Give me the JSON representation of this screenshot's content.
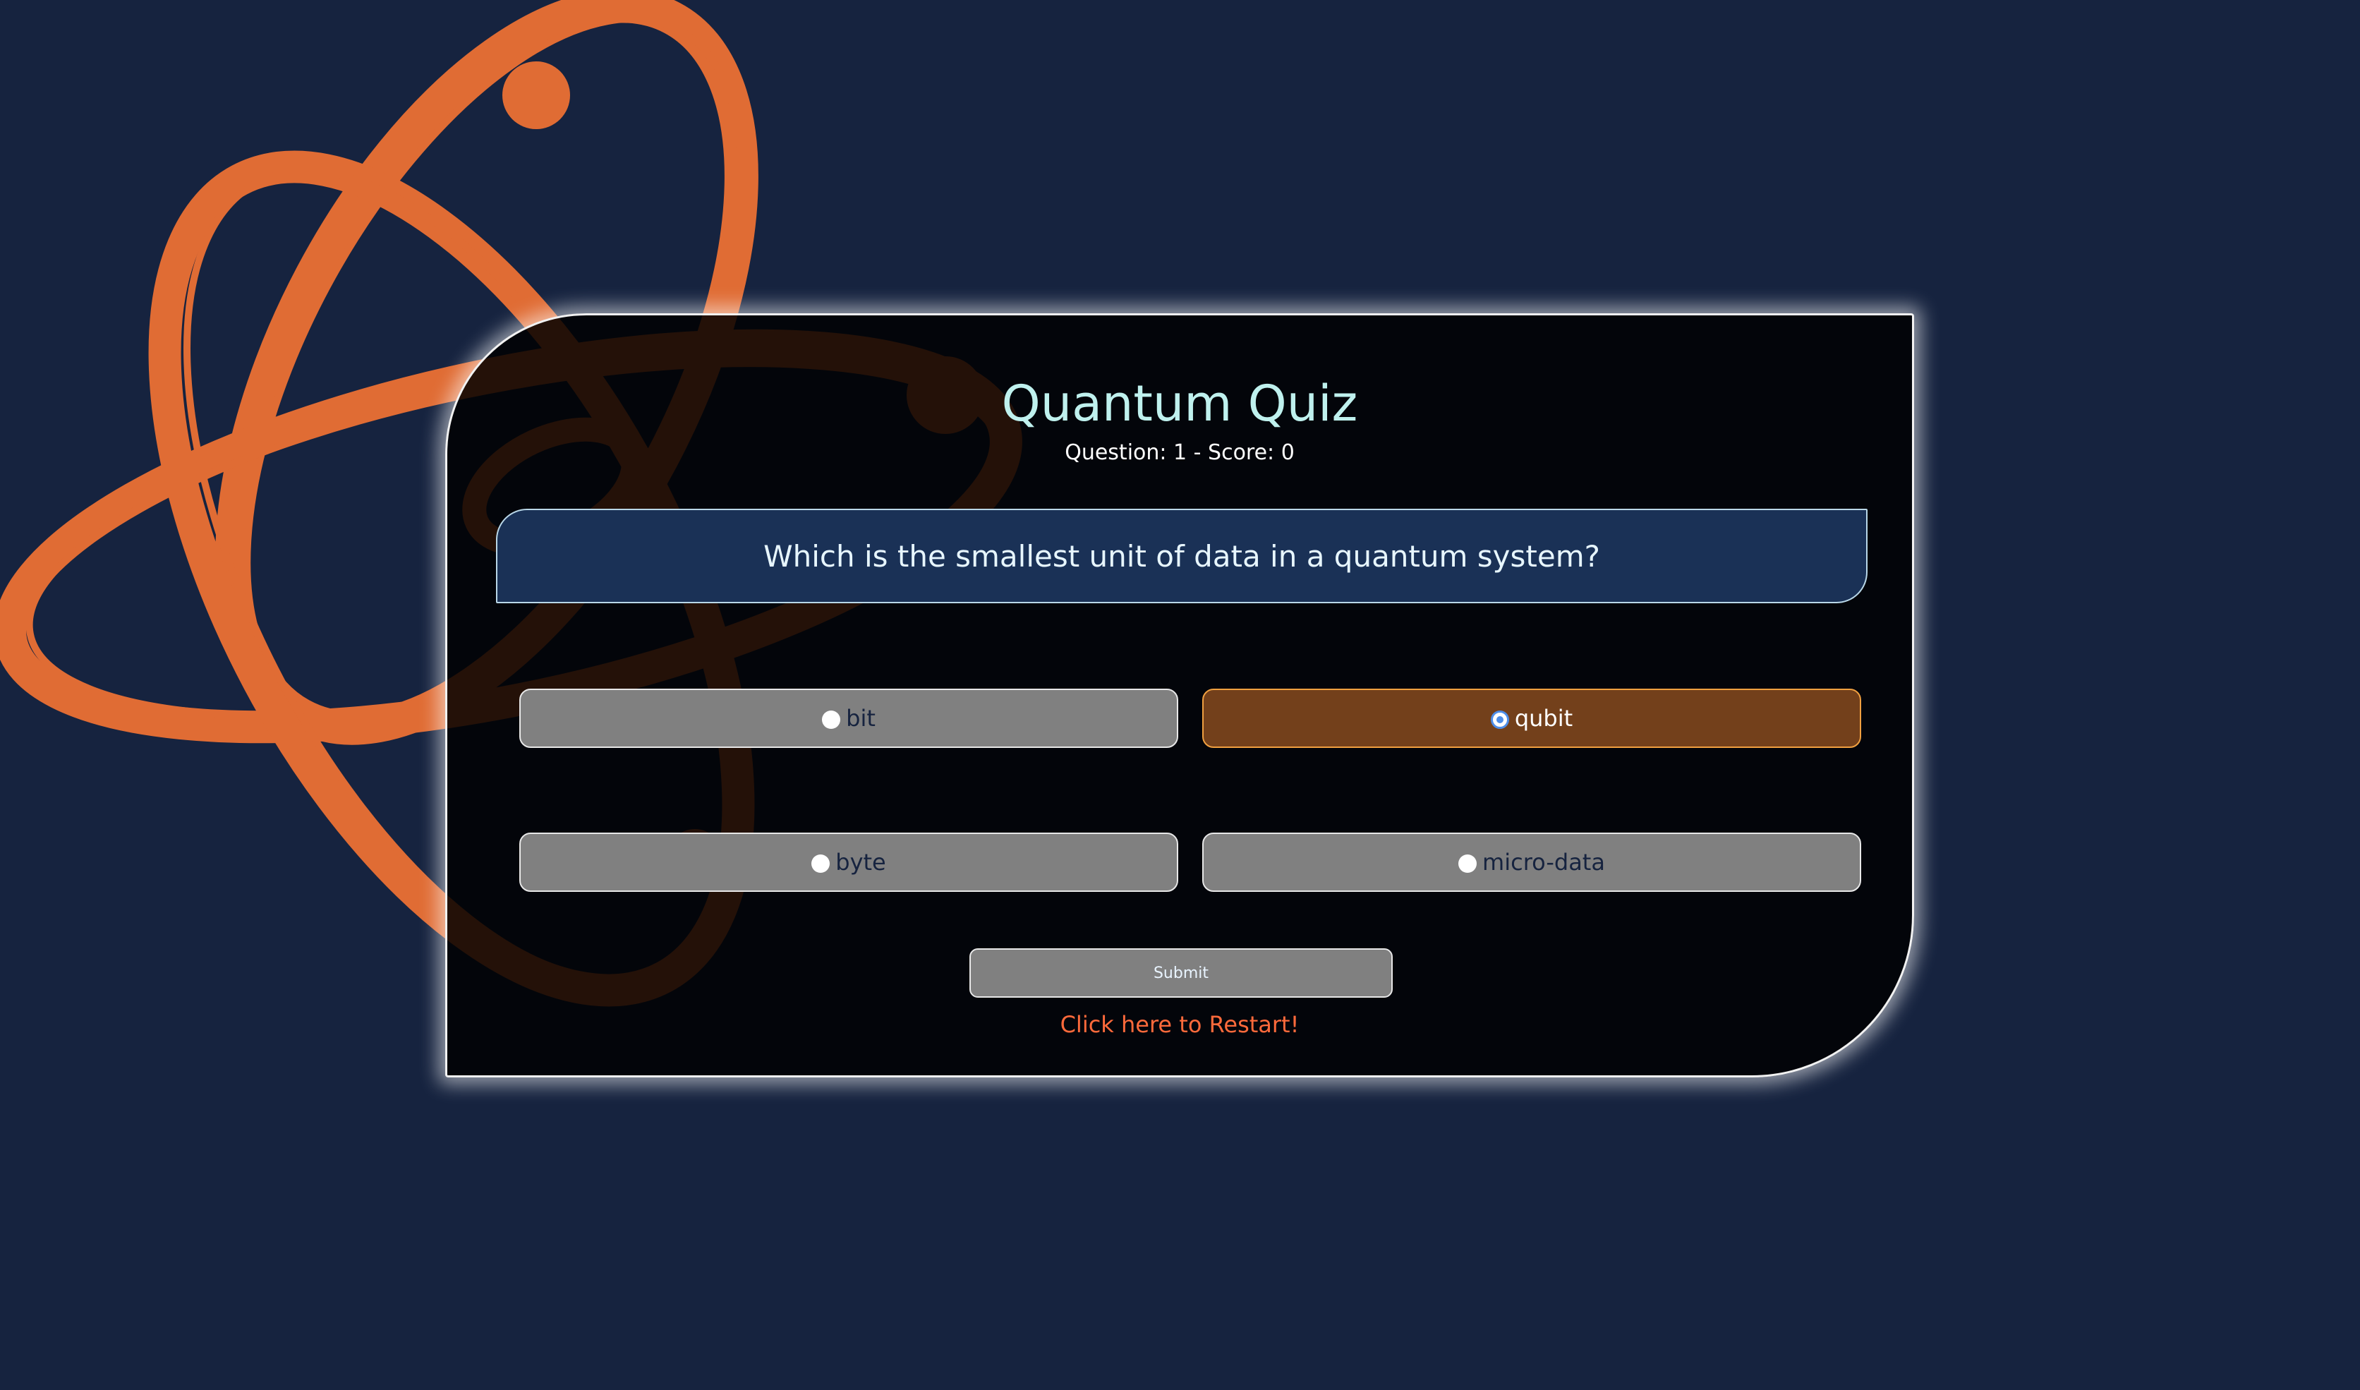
{
  "quiz": {
    "title": "Quantum Quiz",
    "status": "Question: 1 - Score: 0",
    "question": "Which is the smallest unit of data in a quantum system?",
    "options": [
      {
        "label": "bit",
        "selected": false
      },
      {
        "label": "qubit",
        "selected": true
      },
      {
        "label": "byte",
        "selected": false
      },
      {
        "label": "micro-data",
        "selected": false
      }
    ],
    "submit_label": "Submit",
    "restart_label": "Click here to Restart!"
  },
  "colors": {
    "background": "#16233f",
    "atom_logo": "#e06c34",
    "selected_option": "#73401b",
    "title": "#bff1ee",
    "restart": "#ff6a3b"
  },
  "icons": {
    "background_logo": "atom-icon"
  }
}
